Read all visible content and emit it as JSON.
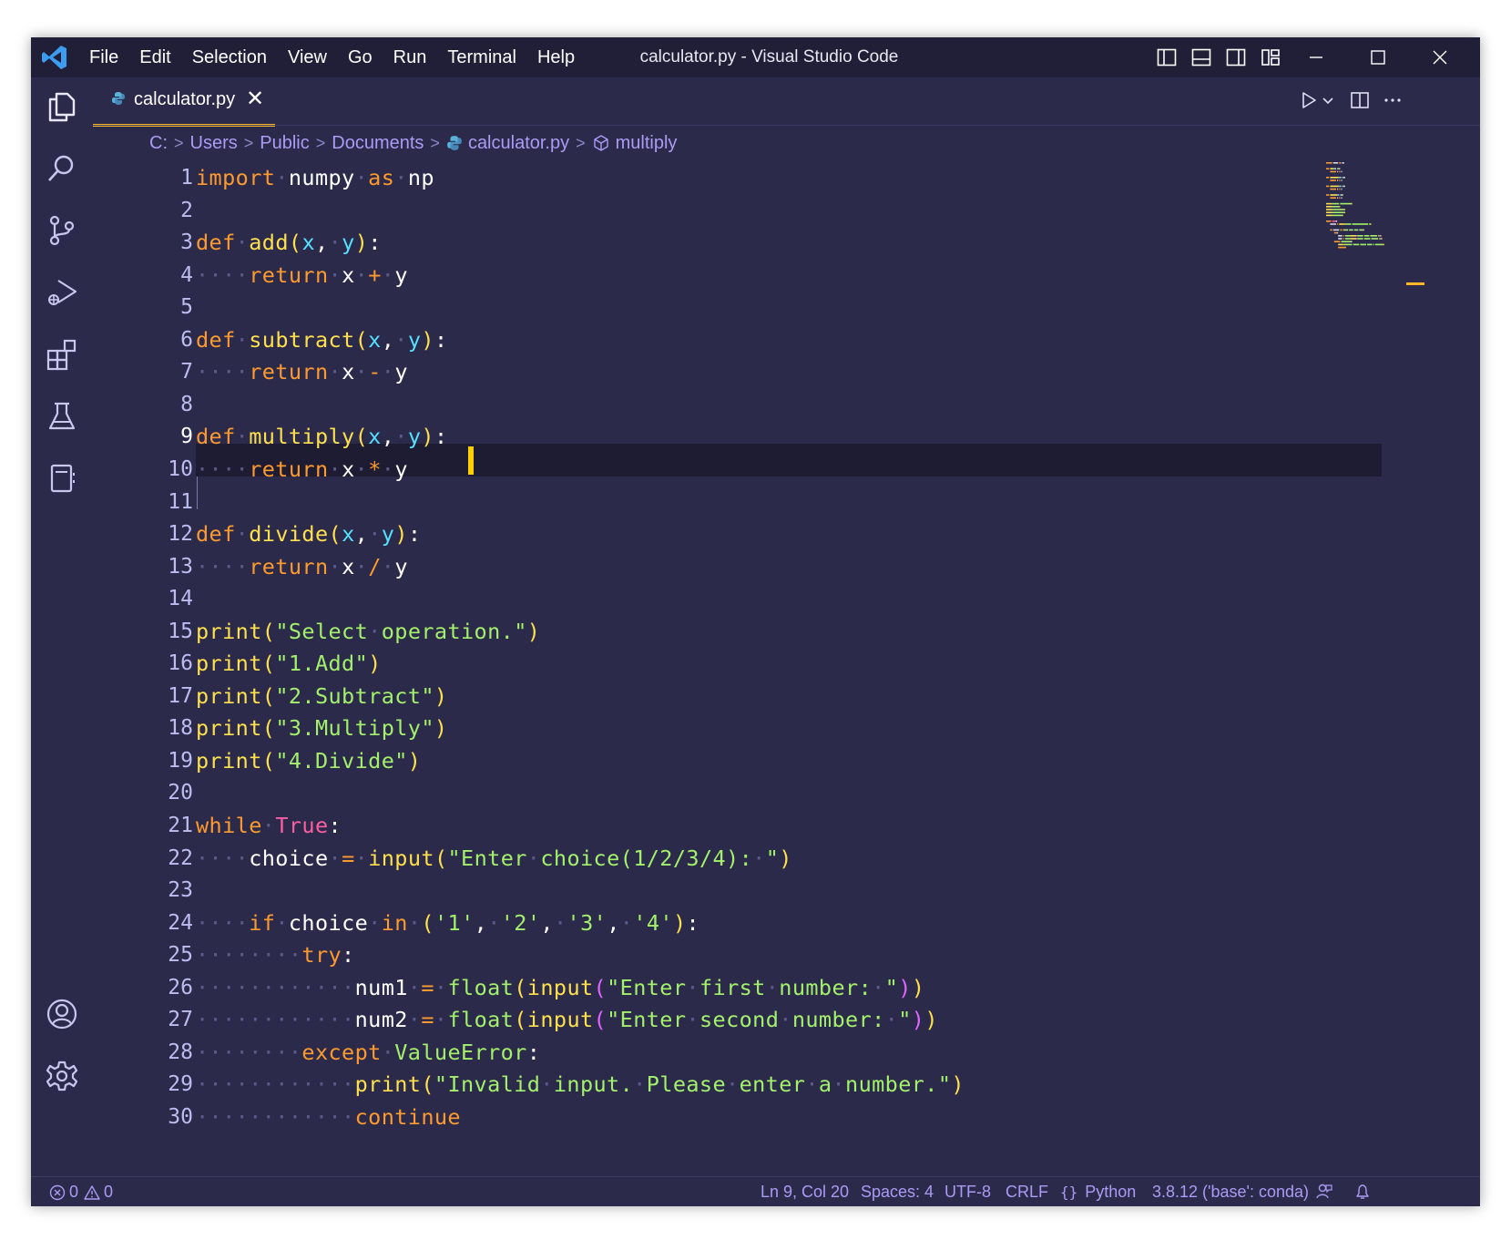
{
  "window": {
    "title": "calculator.py - Visual Studio Code",
    "menu": [
      "File",
      "Edit",
      "Selection",
      "View",
      "Go",
      "Run",
      "Terminal",
      "Help"
    ]
  },
  "tab": {
    "filename": "calculator.py",
    "close_glyph": "✕"
  },
  "breadcrumb": [
    "C:",
    "Users",
    "Public",
    "Documents",
    "calculator.py",
    "multiply"
  ],
  "editor": {
    "active_line": 9,
    "lines": [
      [
        [
          "kw",
          "import"
        ],
        [
          "ws",
          "·"
        ],
        [
          "pn",
          "numpy"
        ],
        [
          "ws",
          "·"
        ],
        [
          "kw",
          "as"
        ],
        [
          "ws",
          "·"
        ],
        [
          "pn",
          "np"
        ]
      ],
      [],
      [
        [
          "kw",
          "def"
        ],
        [
          "ws",
          "·"
        ],
        [
          "fn",
          "add"
        ],
        [
          "br",
          "("
        ],
        [
          "prm",
          "x"
        ],
        [
          "pn",
          ","
        ],
        [
          "ws",
          "·"
        ],
        [
          "prm",
          "y"
        ],
        [
          "br",
          ")"
        ],
        [
          "pn",
          ":"
        ]
      ],
      [
        [
          "ws",
          "····"
        ],
        [
          "kw",
          "return"
        ],
        [
          "ws",
          "·"
        ],
        [
          "pn",
          "x"
        ],
        [
          "ws",
          "·"
        ],
        [
          "op",
          "+"
        ],
        [
          "ws",
          "·"
        ],
        [
          "pn",
          "y"
        ]
      ],
      [],
      [
        [
          "kw",
          "def"
        ],
        [
          "ws",
          "·"
        ],
        [
          "fn",
          "subtract"
        ],
        [
          "br",
          "("
        ],
        [
          "prm",
          "x"
        ],
        [
          "pn",
          ","
        ],
        [
          "ws",
          "·"
        ],
        [
          "prm",
          "y"
        ],
        [
          "br",
          ")"
        ],
        [
          "pn",
          ":"
        ]
      ],
      [
        [
          "ws",
          "····"
        ],
        [
          "kw",
          "return"
        ],
        [
          "ws",
          "·"
        ],
        [
          "pn",
          "x"
        ],
        [
          "ws",
          "·"
        ],
        [
          "op",
          "-"
        ],
        [
          "ws",
          "·"
        ],
        [
          "pn",
          "y"
        ]
      ],
      [],
      [
        [
          "kw",
          "def"
        ],
        [
          "ws",
          "·"
        ],
        [
          "fn",
          "multiply"
        ],
        [
          "br",
          "("
        ],
        [
          "prm",
          "x"
        ],
        [
          "pn",
          ","
        ],
        [
          "ws",
          "·"
        ],
        [
          "prm",
          "y"
        ],
        [
          "br",
          ")"
        ],
        [
          "pn",
          ":"
        ]
      ],
      [
        [
          "ws",
          "····"
        ],
        [
          "kw",
          "return"
        ],
        [
          "ws",
          "·"
        ],
        [
          "pn",
          "x"
        ],
        [
          "ws",
          "·"
        ],
        [
          "op",
          "*"
        ],
        [
          "ws",
          "·"
        ],
        [
          "pn",
          "y"
        ]
      ],
      [],
      [
        [
          "kw",
          "def"
        ],
        [
          "ws",
          "·"
        ],
        [
          "fn",
          "divide"
        ],
        [
          "br",
          "("
        ],
        [
          "prm",
          "x"
        ],
        [
          "pn",
          ","
        ],
        [
          "ws",
          "·"
        ],
        [
          "prm",
          "y"
        ],
        [
          "br",
          ")"
        ],
        [
          "pn",
          ":"
        ]
      ],
      [
        [
          "ws",
          "····"
        ],
        [
          "kw",
          "return"
        ],
        [
          "ws",
          "·"
        ],
        [
          "pn",
          "x"
        ],
        [
          "ws",
          "·"
        ],
        [
          "op",
          "/"
        ],
        [
          "ws",
          "·"
        ],
        [
          "pn",
          "y"
        ]
      ],
      [],
      [
        [
          "fn",
          "print"
        ],
        [
          "br",
          "("
        ],
        [
          "str",
          "\"Select"
        ],
        [
          "ws",
          "·"
        ],
        [
          "str",
          "operation.\""
        ],
        [
          "br",
          ")"
        ]
      ],
      [
        [
          "fn",
          "print"
        ],
        [
          "br",
          "("
        ],
        [
          "str",
          "\"1.Add\""
        ],
        [
          "br",
          ")"
        ]
      ],
      [
        [
          "fn",
          "print"
        ],
        [
          "br",
          "("
        ],
        [
          "str",
          "\"2.Subtract\""
        ],
        [
          "br",
          ")"
        ]
      ],
      [
        [
          "fn",
          "print"
        ],
        [
          "br",
          "("
        ],
        [
          "str",
          "\"3.Multiply\""
        ],
        [
          "br",
          ")"
        ]
      ],
      [
        [
          "fn",
          "print"
        ],
        [
          "br",
          "("
        ],
        [
          "str",
          "\"4.Divide\""
        ],
        [
          "br",
          ")"
        ]
      ],
      [],
      [
        [
          "kw",
          "while"
        ],
        [
          "ws",
          "·"
        ],
        [
          "tr",
          "True"
        ],
        [
          "pn",
          ":"
        ]
      ],
      [
        [
          "ws",
          "····"
        ],
        [
          "pn",
          "choice"
        ],
        [
          "ws",
          "·"
        ],
        [
          "op",
          "="
        ],
        [
          "ws",
          "·"
        ],
        [
          "fn",
          "input"
        ],
        [
          "br",
          "("
        ],
        [
          "str",
          "\"Enter"
        ],
        [
          "ws",
          "·"
        ],
        [
          "str",
          "choice(1/2/3/4):"
        ],
        [
          "ws",
          "·"
        ],
        [
          "str",
          "\""
        ],
        [
          "br",
          ")"
        ]
      ],
      [],
      [
        [
          "ws",
          "····"
        ],
        [
          "kw",
          "if"
        ],
        [
          "ws",
          "·"
        ],
        [
          "pn",
          "choice"
        ],
        [
          "ws",
          "·"
        ],
        [
          "kw",
          "in"
        ],
        [
          "ws",
          "·"
        ],
        [
          "br",
          "("
        ],
        [
          "str",
          "'1'"
        ],
        [
          "pn",
          ","
        ],
        [
          "ws",
          "·"
        ],
        [
          "str",
          "'2'"
        ],
        [
          "pn",
          ","
        ],
        [
          "ws",
          "·"
        ],
        [
          "str",
          "'3'"
        ],
        [
          "pn",
          ","
        ],
        [
          "ws",
          "·"
        ],
        [
          "str",
          "'4'"
        ],
        [
          "br",
          ")"
        ],
        [
          "pn",
          ":"
        ]
      ],
      [
        [
          "ws",
          "········"
        ],
        [
          "kw",
          "try"
        ],
        [
          "pn",
          ":"
        ]
      ],
      [
        [
          "ws",
          "············"
        ],
        [
          "pn",
          "num1"
        ],
        [
          "ws",
          "·"
        ],
        [
          "op",
          "="
        ],
        [
          "ws",
          "·"
        ],
        [
          "cl",
          "float"
        ],
        [
          "br",
          "("
        ],
        [
          "fn",
          "input"
        ],
        [
          "br2",
          "("
        ],
        [
          "str",
          "\"Enter"
        ],
        [
          "ws",
          "·"
        ],
        [
          "str",
          "first"
        ],
        [
          "ws",
          "·"
        ],
        [
          "str",
          "number:"
        ],
        [
          "ws",
          "·"
        ],
        [
          "str",
          "\""
        ],
        [
          "br2",
          ")"
        ],
        [
          "br",
          ")"
        ]
      ],
      [
        [
          "ws",
          "············"
        ],
        [
          "pn",
          "num2"
        ],
        [
          "ws",
          "·"
        ],
        [
          "op",
          "="
        ],
        [
          "ws",
          "·"
        ],
        [
          "cl",
          "float"
        ],
        [
          "br",
          "("
        ],
        [
          "fn",
          "input"
        ],
        [
          "br2",
          "("
        ],
        [
          "str",
          "\"Enter"
        ],
        [
          "ws",
          "·"
        ],
        [
          "str",
          "second"
        ],
        [
          "ws",
          "·"
        ],
        [
          "str",
          "number:"
        ],
        [
          "ws",
          "·"
        ],
        [
          "str",
          "\""
        ],
        [
          "br2",
          ")"
        ],
        [
          "br",
          ")"
        ]
      ],
      [
        [
          "ws",
          "········"
        ],
        [
          "kw",
          "except"
        ],
        [
          "ws",
          "·"
        ],
        [
          "cl",
          "ValueError"
        ],
        [
          "pn",
          ":"
        ]
      ],
      [
        [
          "ws",
          "············"
        ],
        [
          "fn",
          "print"
        ],
        [
          "br",
          "("
        ],
        [
          "str",
          "\"Invalid"
        ],
        [
          "ws",
          "·"
        ],
        [
          "str",
          "input."
        ],
        [
          "ws",
          "·"
        ],
        [
          "str",
          "Please"
        ],
        [
          "ws",
          "·"
        ],
        [
          "str",
          "enter"
        ],
        [
          "ws",
          "·"
        ],
        [
          "str",
          "a"
        ],
        [
          "ws",
          "·"
        ],
        [
          "str",
          "number.\""
        ],
        [
          "br",
          ")"
        ]
      ],
      [
        [
          "ws",
          "············"
        ],
        [
          "kw",
          "continue"
        ]
      ]
    ]
  },
  "status": {
    "errors": "0",
    "warnings": "0",
    "position": "Ln 9, Col 20",
    "spaces": "Spaces: 4",
    "encoding": "UTF-8",
    "eol": "CRLF",
    "language": "Python",
    "interpreter": "3.8.12 ('base': conda)"
  },
  "colors": {
    "background": "#2b2a4a",
    "titlebar": "#201f37",
    "accent": "#ffb627",
    "keyword": "#ff9a2f",
    "function": "#ffe04d",
    "string": "#a3f06b",
    "parameter": "#56e0ff"
  }
}
